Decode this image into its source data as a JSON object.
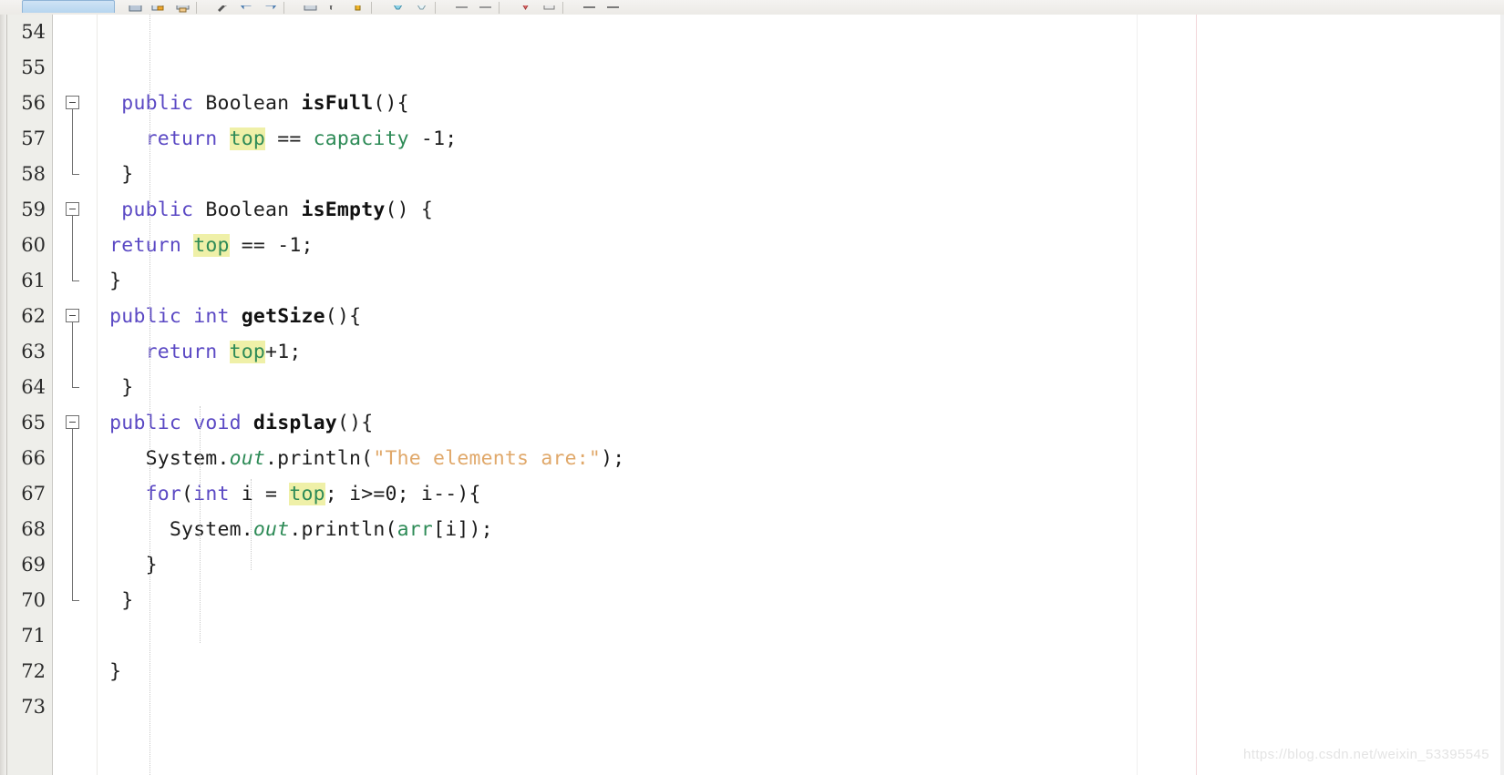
{
  "app": {
    "type": "java-code-editor",
    "watermark": "https://blog.csdn.net/weixin_53395545"
  },
  "toolbar": {
    "icons": [
      "save-icon",
      "save-all-icon",
      "print-icon",
      "build-icon",
      "back-icon",
      "forward-icon",
      "open-type-icon",
      "search-icon",
      "debug-icon",
      "run-icon",
      "run-last-icon",
      "next-annotation-icon",
      "previous-annotation-icon",
      "bookmark-icon",
      "collapse-all-icon",
      "link-editor-icon",
      "view-menu-icon"
    ],
    "tab_label": ""
  },
  "editor": {
    "first_line": 54,
    "last_line": 73,
    "line_numbers": [
      54,
      55,
      56,
      57,
      58,
      59,
      60,
      61,
      62,
      63,
      64,
      65,
      66,
      67,
      68,
      69,
      70,
      71,
      72,
      73
    ],
    "fold_markers": [
      {
        "line": 56,
        "state": "expanded"
      },
      {
        "line": 59,
        "state": "expanded"
      },
      {
        "line": 62,
        "state": "expanded"
      },
      {
        "line": 65,
        "state": "expanded"
      }
    ],
    "highlight_token": "top",
    "highlight_color": "#eff0a8",
    "ruler_color": "#f2d6d9",
    "gutter_background": "#eeeeea",
    "background": "#ffffff",
    "lines": [
      {
        "n": 54,
        "segments": []
      },
      {
        "n": 55,
        "segments": []
      },
      {
        "n": 56,
        "segments": [
          {
            "t": "  ",
            "c": "plain"
          },
          {
            "t": "public",
            "c": "kw"
          },
          {
            "t": " Boolean ",
            "c": "plain"
          },
          {
            "t": "isFull",
            "c": "mname"
          },
          {
            "t": "(){",
            "c": "plain"
          }
        ]
      },
      {
        "n": 57,
        "segments": [
          {
            "t": "    ",
            "c": "plain"
          },
          {
            "t": "return",
            "c": "kw"
          },
          {
            "t": " ",
            "c": "plain"
          },
          {
            "t": "top",
            "c": "hl"
          },
          {
            "t": " == ",
            "c": "plain"
          },
          {
            "t": "capacity",
            "c": "fld"
          },
          {
            "t": " -1;",
            "c": "plain"
          }
        ]
      },
      {
        "n": 58,
        "segments": [
          {
            "t": "  }",
            "c": "plain"
          }
        ]
      },
      {
        "n": 59,
        "segments": [
          {
            "t": "  ",
            "c": "plain"
          },
          {
            "t": "public",
            "c": "kw"
          },
          {
            "t": " Boolean ",
            "c": "plain"
          },
          {
            "t": "isEmpty",
            "c": "mname"
          },
          {
            "t": "() {",
            "c": "plain"
          }
        ]
      },
      {
        "n": 60,
        "segments": [
          {
            "t": " ",
            "c": "plain"
          },
          {
            "t": "return",
            "c": "kw"
          },
          {
            "t": " ",
            "c": "plain"
          },
          {
            "t": "top",
            "c": "hl"
          },
          {
            "t": " == -1;",
            "c": "plain"
          }
        ]
      },
      {
        "n": 61,
        "segments": [
          {
            "t": " }",
            "c": "plain"
          }
        ]
      },
      {
        "n": 62,
        "segments": [
          {
            "t": " ",
            "c": "plain"
          },
          {
            "t": "public",
            "c": "kw"
          },
          {
            "t": " ",
            "c": "plain"
          },
          {
            "t": "int",
            "c": "kw"
          },
          {
            "t": " ",
            "c": "plain"
          },
          {
            "t": "getSize",
            "c": "mname"
          },
          {
            "t": "(){",
            "c": "plain"
          }
        ]
      },
      {
        "n": 63,
        "segments": [
          {
            "t": "    ",
            "c": "plain"
          },
          {
            "t": "return",
            "c": "kw"
          },
          {
            "t": " ",
            "c": "plain"
          },
          {
            "t": "top",
            "c": "hl"
          },
          {
            "t": "+1;",
            "c": "plain"
          }
        ]
      },
      {
        "n": 64,
        "segments": [
          {
            "t": "  }",
            "c": "plain"
          }
        ]
      },
      {
        "n": 65,
        "segments": [
          {
            "t": " ",
            "c": "plain"
          },
          {
            "t": "public",
            "c": "kw"
          },
          {
            "t": " ",
            "c": "plain"
          },
          {
            "t": "void",
            "c": "kw"
          },
          {
            "t": " ",
            "c": "plain"
          },
          {
            "t": "display",
            "c": "mname"
          },
          {
            "t": "(){",
            "c": "plain"
          }
        ]
      },
      {
        "n": 66,
        "segments": [
          {
            "t": "    ",
            "c": "plain"
          },
          {
            "t": "System.",
            "c": "plain"
          },
          {
            "t": "out",
            "c": "ital"
          },
          {
            "t": ".println(",
            "c": "plain"
          },
          {
            "t": "\"The elements are:\"",
            "c": "str"
          },
          {
            "t": ");",
            "c": "plain"
          }
        ]
      },
      {
        "n": 67,
        "segments": [
          {
            "t": "    ",
            "c": "plain"
          },
          {
            "t": "for",
            "c": "kw"
          },
          {
            "t": "(",
            "c": "plain"
          },
          {
            "t": "int",
            "c": "kw"
          },
          {
            "t": " i = ",
            "c": "plain"
          },
          {
            "t": "top",
            "c": "hl"
          },
          {
            "t": "; i>=0; i--){",
            "c": "plain"
          }
        ]
      },
      {
        "n": 68,
        "segments": [
          {
            "t": "      ",
            "c": "plain"
          },
          {
            "t": "System.",
            "c": "plain"
          },
          {
            "t": "out",
            "c": "ital"
          },
          {
            "t": ".println(",
            "c": "plain"
          },
          {
            "t": "arr",
            "c": "fld"
          },
          {
            "t": "[i]);",
            "c": "plain"
          }
        ]
      },
      {
        "n": 69,
        "segments": [
          {
            "t": "    }",
            "c": "plain"
          }
        ]
      },
      {
        "n": 70,
        "segments": [
          {
            "t": "  }",
            "c": "plain"
          }
        ]
      },
      {
        "n": 71,
        "segments": []
      },
      {
        "n": 72,
        "segments": [
          {
            "t": " }",
            "c": "plain"
          }
        ]
      },
      {
        "n": 73,
        "segments": []
      }
    ]
  }
}
